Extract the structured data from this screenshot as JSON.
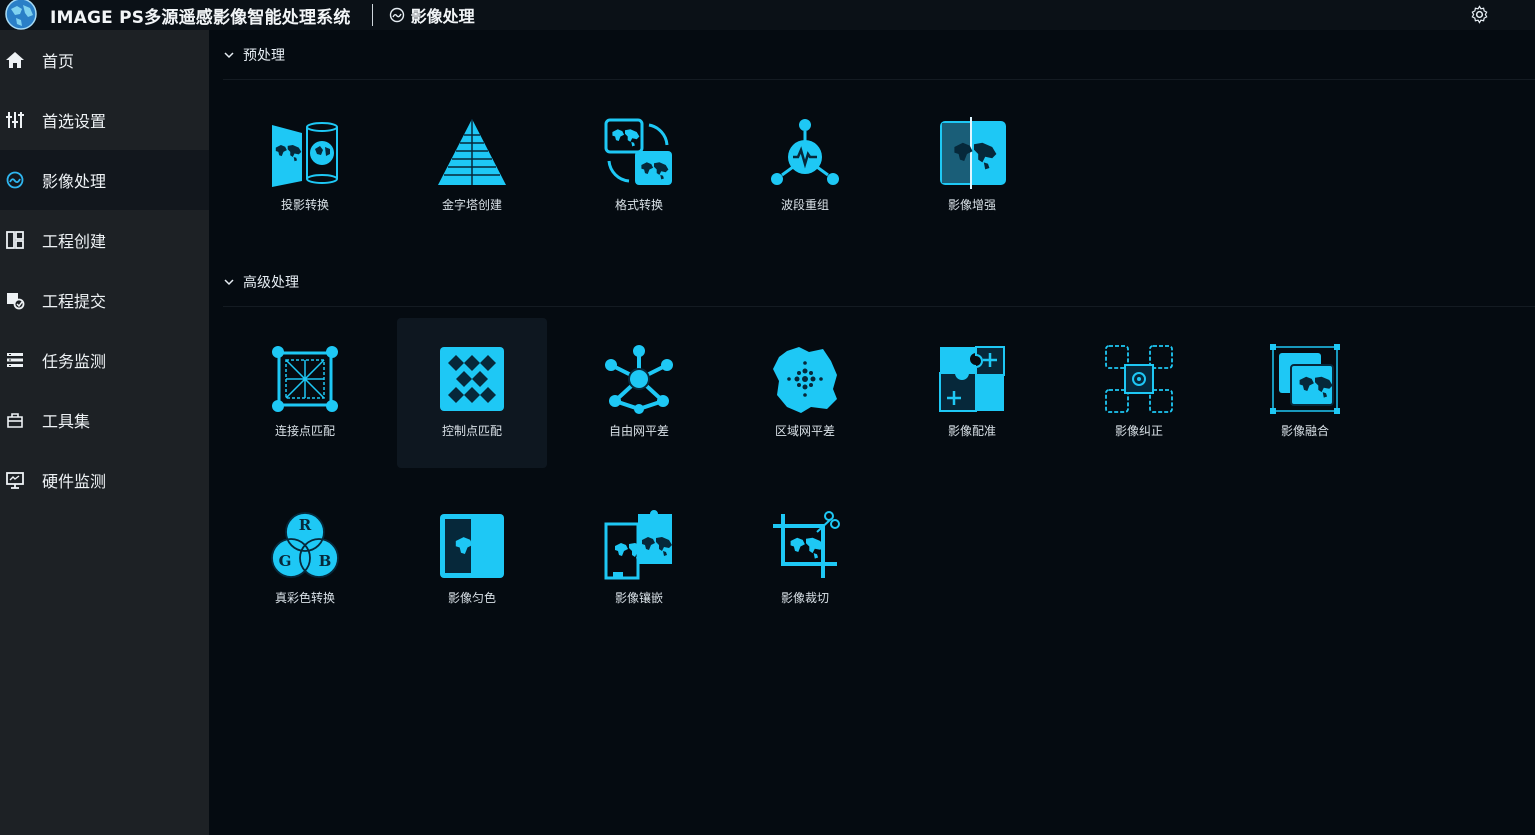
{
  "app": {
    "title": "IMAGE PS多源遥感影像智能处理系统",
    "breadcrumb": "影像处理"
  },
  "colors": {
    "accent": "#1ec8f5",
    "background": "#050b11",
    "sidebar": "#1d2125"
  },
  "sidebar": {
    "items": [
      {
        "label": "首页",
        "icon": "home-icon"
      },
      {
        "label": "首选设置",
        "icon": "sliders-icon"
      },
      {
        "label": "影像处理",
        "icon": "image-process-icon",
        "active": true
      },
      {
        "label": "工程创建",
        "icon": "layout-icon"
      },
      {
        "label": "工程提交",
        "icon": "submit-icon"
      },
      {
        "label": "任务监测",
        "icon": "list-icon"
      },
      {
        "label": "工具集",
        "icon": "toolbox-icon"
      },
      {
        "label": "硬件监测",
        "icon": "monitor-icon"
      }
    ]
  },
  "sections": {
    "pre": {
      "title": "预处理",
      "tools": [
        {
          "label": "投影转换",
          "icon": "projection-icon"
        },
        {
          "label": "金字塔创建",
          "icon": "pyramid-icon"
        },
        {
          "label": "格式转换",
          "icon": "format-convert-icon"
        },
        {
          "label": "波段重组",
          "icon": "band-recombine-icon"
        },
        {
          "label": "影像增强",
          "icon": "image-enhance-icon"
        }
      ]
    },
    "adv": {
      "title": "高级处理",
      "tools": [
        {
          "label": "连接点匹配",
          "icon": "tiepoint-match-icon"
        },
        {
          "label": "控制点匹配",
          "icon": "controlpoint-match-icon",
          "selected": true
        },
        {
          "label": "自由网平差",
          "icon": "free-network-icon"
        },
        {
          "label": "区域网平差",
          "icon": "block-adjust-icon"
        },
        {
          "label": "影像配准",
          "icon": "registration-icon"
        },
        {
          "label": "影像纠正",
          "icon": "rectify-icon"
        },
        {
          "label": "影像融合",
          "icon": "fusion-icon"
        },
        {
          "label": "真彩色转换",
          "icon": "truecolor-icon",
          "rgb": [
            "R",
            "G",
            "B"
          ]
        },
        {
          "label": "影像匀色",
          "icon": "color-balance-icon"
        },
        {
          "label": "影像镶嵌",
          "icon": "mosaic-icon"
        },
        {
          "label": "影像裁切",
          "icon": "crop-icon"
        }
      ]
    }
  }
}
